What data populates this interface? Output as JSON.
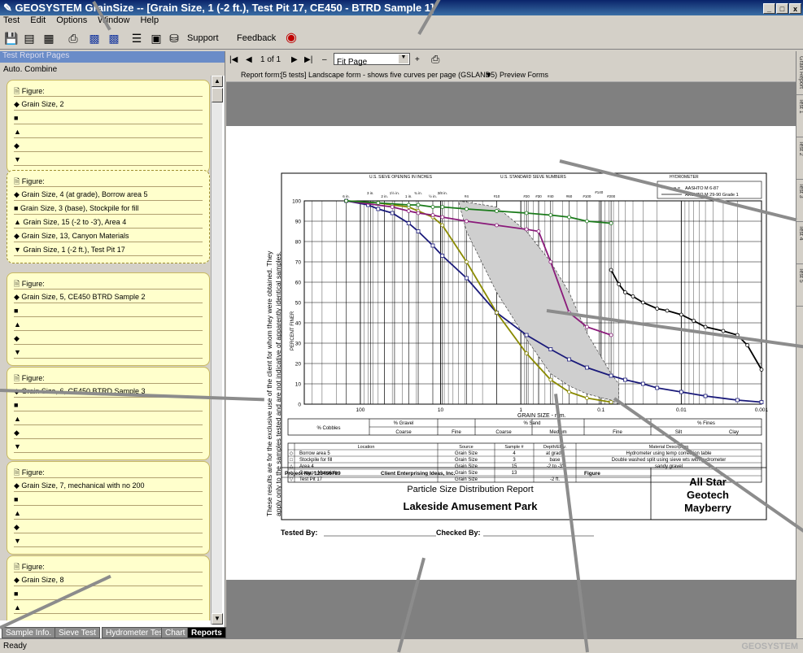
{
  "window": {
    "title": "GEOSYSTEM GrainSize -- [Grain Size, 1 (-2 ft.), Test Pit 17, CE450 - BTRD Sample 1]"
  },
  "menu": [
    "Test",
    "Edit",
    "Options",
    "Window",
    "Help"
  ],
  "toolbar": {
    "support": "Support",
    "feedback": "Feedback"
  },
  "sidebar": {
    "header": "Test Report Pages",
    "subheader": "Auto. Combine",
    "figure_label": "Figure:",
    "cards": [
      {
        "rows": [
          "Grain Size, 2",
          "",
          "",
          "",
          ""
        ]
      },
      {
        "rows": [
          "Grain Size, 4 (at grade), Borrow area 5",
          "Grain Size, 3 (base), Stockpile for fill",
          "Grain Size, 15 (-2 to -3'), Area 4",
          "Grain Size, 13, Canyon Materials",
          "Grain Size, 1 (-2 ft.), Test Pit 17"
        ]
      },
      {
        "rows": [
          "Grain Size, 5, CE450 BTRD Sample 2",
          "",
          "",
          "",
          ""
        ]
      },
      {
        "rows": [
          "Grain Size, 6, CE450 BTRD Sample 3",
          "",
          "",
          "",
          ""
        ]
      },
      {
        "rows": [
          "Grain Size, 7, mechanical with no 200",
          "",
          "",
          "",
          ""
        ]
      },
      {
        "rows": [
          "Grain Size, 8",
          "",
          "",
          ""
        ]
      }
    ],
    "tabs": [
      "Sample Info.",
      "Sieve Test",
      "Hydrometer Test",
      "Chart",
      "Reports"
    ]
  },
  "pager": {
    "page": "1 of 1",
    "zoom": "Fit Page"
  },
  "report_form": {
    "label": "Report form:",
    "value": "[5 tests] Landscape form - shows five curves per page (GSLAND5)",
    "preview": "Preview Forms"
  },
  "right_tabs": [
    "Grain Report",
    "Test 1",
    "Test 2",
    "Test 3",
    "Test 4",
    "Test 5"
  ],
  "report": {
    "side_text_1": "These results are for the exclusive use of the client for whom they were obtained. They",
    "side_text_2": "apply only to the samples tested and are not indicative of apparently identical samples.",
    "ylabel": "PERCENT FINER",
    "xlabel": "GRAIN SIZE - mm.",
    "top_label_1": "U.S. SIEVE OPENING IN INCHES",
    "top_label_2": "U.S. STANDARD SIEVE NUMBERS",
    "top_label_3": "HYDROMETER",
    "sieve_inch": [
      "6 in.",
      "3 in.",
      "2 in.",
      "1½ in.",
      "1 in.",
      "¾ in.",
      "½ in.",
      "3/8 in."
    ],
    "sieve_num": [
      "#4",
      "#10",
      "#20",
      "#30",
      "#40",
      "#60",
      "#100",
      "#140",
      "#200"
    ],
    "legend": [
      "AASHTO M 6-87",
      "AASHTO M 29-90 Grade 1"
    ],
    "yticks": [
      "100",
      "90",
      "80",
      "70",
      "60",
      "50",
      "40",
      "30",
      "20",
      "10",
      "0"
    ],
    "xticks": [
      "100",
      "10",
      "1",
      "0.1",
      "0.01",
      "0.001"
    ],
    "classes": {
      "cobbles": "% Cobbles",
      "gravel": "% Gravel",
      "sand": "% Sand",
      "fines": "% Fines",
      "coarse": "Coarse",
      "fine": "Fine",
      "medium": "Medium",
      "silt": "Silt",
      "clay": "Clay"
    },
    "table_headers": [
      "Location",
      "Source",
      "Sample #",
      "Depth/Elev.",
      "Material Description"
    ],
    "rows": [
      [
        "Borrow area 5",
        "Grain Size",
        "4",
        "at grade",
        "Hydrometer using temp correction table"
      ],
      [
        "Stockpile for fill",
        "Grain Size",
        "3",
        "base",
        "Double washed split using sieve wts with hydrometer"
      ],
      [
        "Area 4",
        "Grain Size",
        "15",
        "-2 to -3'",
        "sandy gravel"
      ],
      [
        "Canyon Materials",
        "Grain Size",
        "13",
        "",
        ""
      ],
      [
        "Test Pit 17",
        "Grain Size",
        "",
        "-2 ft.",
        ""
      ]
    ],
    "project_no": "Project No. 123456789",
    "client": "Client Enterprising Ideas, Inc.",
    "figure": "Figure",
    "report_title": "Particle Size Distribution Report",
    "project_name": "Lakeside Amusement Park",
    "company": [
      "All Star",
      "Geotech",
      "Mayberry"
    ],
    "tested_by": "Tested By:",
    "checked_by": "Checked By:"
  },
  "chart_data": {
    "type": "line",
    "xscale": "log",
    "xlabel": "GRAIN SIZE - mm.",
    "ylabel": "PERCENT FINER",
    "ylim": [
      0,
      100
    ],
    "xlim": [
      500,
      0.001
    ],
    "series": [
      {
        "color": "#1a1a7a",
        "x": [
          150,
          80,
          60,
          40,
          25,
          19,
          12.5,
          9.5,
          4.75,
          2,
          0.85,
          0.425,
          0.25,
          0.15,
          0.075,
          0.05,
          0.03,
          0.02,
          0.01,
          0.005,
          0.002,
          0.001
        ],
        "y": [
          100,
          98,
          96,
          94,
          89,
          85,
          78,
          73,
          62,
          45,
          34,
          27,
          22,
          18,
          14,
          12,
          10,
          8,
          6,
          4,
          2,
          1
        ]
      },
      {
        "color": "#8a8a00",
        "x": [
          150,
          60,
          40,
          25,
          19,
          12.5,
          9.5,
          4.75,
          2,
          0.85,
          0.425,
          0.25,
          0.15,
          0.075
        ],
        "y": [
          100,
          99,
          98,
          97,
          95,
          92,
          88,
          70,
          45,
          25,
          12,
          6,
          3,
          1
        ]
      },
      {
        "color": "#8a1a7a",
        "x": [
          150,
          40,
          25,
          19,
          12.5,
          9.5,
          4.75,
          2,
          0.85,
          0.6,
          0.425,
          0.25,
          0.15,
          0.075
        ],
        "y": [
          100,
          97,
          95,
          94,
          93,
          92,
          90,
          88,
          86,
          85,
          70,
          45,
          38,
          34
        ]
      },
      {
        "color": "#1a7a1a",
        "x": [
          150,
          60,
          25,
          19,
          12.5,
          9.5,
          4.75,
          2,
          0.85,
          0.425,
          0.25,
          0.15,
          0.075
        ],
        "y": [
          100,
          99,
          98,
          98,
          97,
          97,
          96,
          95,
          94,
          93,
          92,
          90,
          89
        ]
      },
      {
        "color": "#000000",
        "x": [
          0.075,
          0.06,
          0.05,
          0.04,
          0.03,
          0.02,
          0.015,
          0.01,
          0.007,
          0.005,
          0.003,
          0.002,
          0.0015,
          0.001
        ],
        "y": [
          66,
          59,
          55,
          53,
          50,
          47,
          46,
          44,
          41,
          38,
          36,
          34,
          29,
          17
        ]
      }
    ]
  }
}
